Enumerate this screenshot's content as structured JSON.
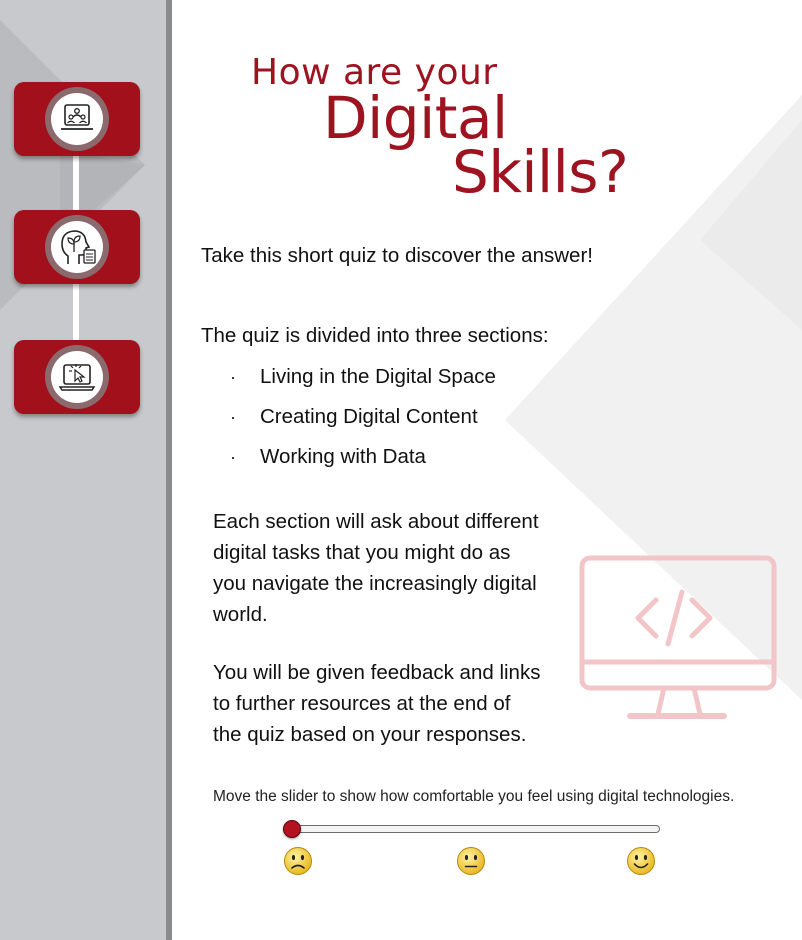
{
  "colors": {
    "brand_red": "#a2101c",
    "title_red": "#9d1320",
    "sidebar_grey": "#c8c9cc",
    "monitor_pink": "#f2c6c8"
  },
  "sidebar": {
    "items": [
      {
        "icon": "people-laptop-icon"
      },
      {
        "icon": "head-plant-icon"
      },
      {
        "icon": "laptop-cursor-icon"
      }
    ]
  },
  "title": {
    "line1": "How are your",
    "line2": "Digital",
    "line3": "Skills?"
  },
  "intro": "Take this short quiz to discover the answer!",
  "sections_intro": "The quiz is divided into three sections:",
  "sections": [
    "Living in the Digital Space",
    "Creating Digital Content",
    "Working with Data"
  ],
  "bullet_char": "·",
  "paragraph1_lines": [
    "Each section will ask about different",
    "digital tasks that you might do as",
    "you navigate the increasingly digital",
    "world."
  ],
  "paragraph2_lines": [
    "You will be given feedback and links",
    "to further resources at the end of",
    "the quiz based on your responses."
  ],
  "decor_icon": "monitor-code-icon",
  "slider": {
    "caption": "Move the slider to show how comfortable you feel using digital technologies.",
    "value": 0,
    "faces": [
      "sad-face-icon",
      "neutral-face-icon",
      "happy-face-icon"
    ]
  }
}
